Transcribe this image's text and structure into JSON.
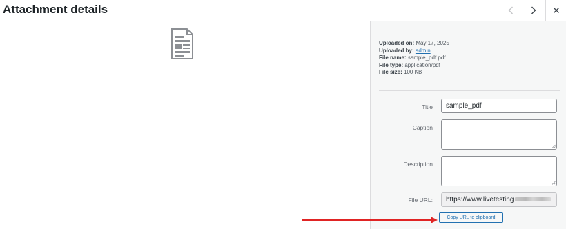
{
  "header": {
    "title": "Attachment details",
    "prev_icon": "chevron-left-icon",
    "next_icon": "chevron-right-icon",
    "close_icon": "close-icon"
  },
  "preview": {
    "icon": "document-icon"
  },
  "details": {
    "uploaded_on_label": "Uploaded on:",
    "uploaded_on_value": "May 17, 2025",
    "uploaded_by_label": "Uploaded by:",
    "uploaded_by_value": "admin",
    "file_name_label": "File name:",
    "file_name_value": "sample_pdf.pdf",
    "file_type_label": "File type:",
    "file_type_value": "application/pdf",
    "file_size_label": "File size:",
    "file_size_value": "100 KB"
  },
  "form": {
    "title_label": "Title",
    "title_value": "sample_pdf",
    "caption_label": "Caption",
    "caption_value": "",
    "description_label": "Description",
    "description_value": "",
    "file_url_label": "File URL:",
    "file_url_value": "https://www.livetesting",
    "copy_button_label": "Copy URL to clipboard"
  },
  "colors": {
    "accent": "#2271b1",
    "annotation_arrow": "#e02424",
    "sidebar_bg": "#f6f7f7"
  }
}
